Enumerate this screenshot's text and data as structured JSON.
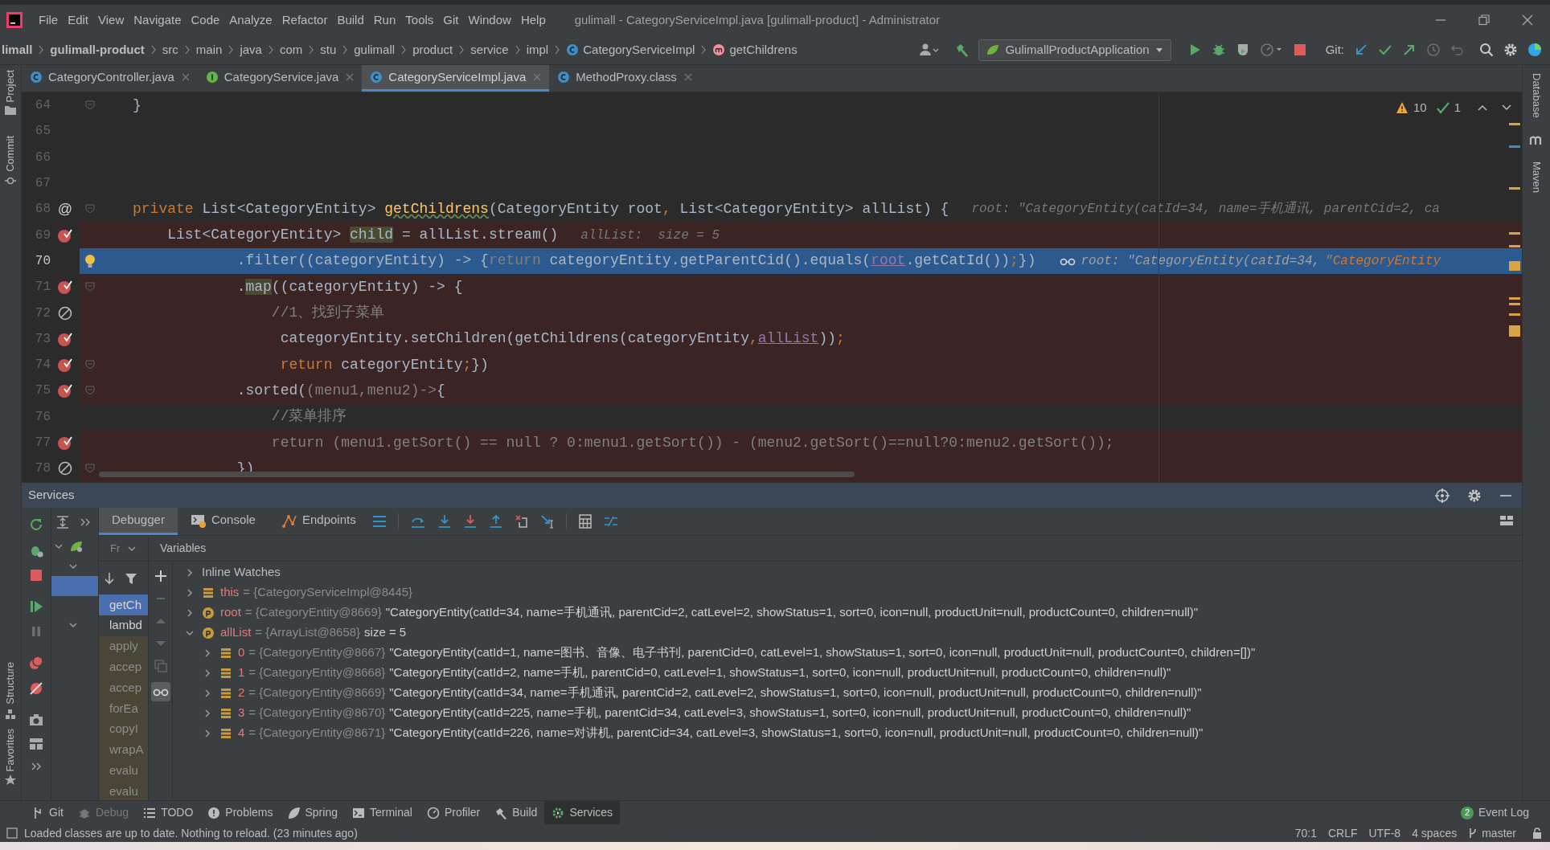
{
  "menu_bar": {
    "items": [
      "File",
      "Edit",
      "View",
      "Navigate",
      "Code",
      "Analyze",
      "Refactor",
      "Build",
      "Run",
      "Tools",
      "Git",
      "Window",
      "Help"
    ],
    "title": "gulimall - CategoryServiceImpl.java [gulimall-product] - Administrator"
  },
  "breadcrumbs": [
    {
      "label": "limall",
      "kind": "module"
    },
    {
      "label": "gulimall-product",
      "kind": "module"
    },
    {
      "label": "src",
      "kind": "folder"
    },
    {
      "label": "main",
      "kind": "folder"
    },
    {
      "label": "java",
      "kind": "folder"
    },
    {
      "label": "com",
      "kind": "folder"
    },
    {
      "label": "stu",
      "kind": "folder"
    },
    {
      "label": "gulimall",
      "kind": "folder"
    },
    {
      "label": "product",
      "kind": "folder"
    },
    {
      "label": "service",
      "kind": "folder"
    },
    {
      "label": "impl",
      "kind": "folder"
    },
    {
      "label": "CategoryServiceImpl",
      "kind": "class"
    },
    {
      "label": "getChildrens",
      "kind": "method"
    }
  ],
  "run_configuration": "GulimallProductApplication",
  "git_label": "Git:",
  "editor_tabs": [
    {
      "label": "CategoryController.java",
      "kind": "class",
      "selected": false
    },
    {
      "label": "CategoryService.java",
      "kind": "interface",
      "selected": false
    },
    {
      "label": "CategoryServiceImpl.java",
      "kind": "class",
      "selected": true
    },
    {
      "label": "MethodProxy.class",
      "kind": "class",
      "selected": false
    }
  ],
  "inspections": {
    "warnings": "10",
    "passed": "1"
  },
  "code_lines": [
    {
      "number": "64",
      "breakpoint": false,
      "fold": true,
      "highlighted": false,
      "current": false,
      "tokens": [
        {
          "kind": "plain",
          "text": "}"
        }
      ]
    },
    {
      "number": "65",
      "breakpoint": false,
      "fold": false,
      "highlighted": false,
      "current": false
    },
    {
      "number": "66",
      "breakpoint": false,
      "fold": false,
      "highlighted": false,
      "current": false
    },
    {
      "number": "67",
      "breakpoint": false,
      "fold": false,
      "highlighted": false,
      "current": false
    },
    {
      "number": "68",
      "breakpoint": false,
      "gutter_text": "@",
      "fold": true,
      "highlighted": false,
      "current": false,
      "tokens": [
        {
          "kind": "keyword",
          "text": "private"
        },
        {
          "kind": "plain",
          "text": " List<CategoryEntity> "
        },
        {
          "kind": "declaration-typo",
          "text": "getChildrens"
        },
        {
          "kind": "plain",
          "text": "(CategoryEntity root"
        },
        {
          "kind": "keyword",
          "text": ", "
        },
        {
          "kind": "plain",
          "text": "List<CategoryEntity> allList) {"
        },
        {
          "kind": "hint",
          "text": "root: \"CategoryEntity(catId=34, name=手机通讯, parentCid=2, ca"
        }
      ]
    },
    {
      "number": "69",
      "breakpoint": true,
      "muted": false,
      "fold": false,
      "highlighted": true,
      "current": false,
      "tokens": [
        {
          "kind": "plain",
          "text": "    List<CategoryEntity> "
        },
        {
          "kind": "usage",
          "text": "child"
        },
        {
          "kind": "plain",
          "text": " = allList.stream()"
        },
        {
          "kind": "hint",
          "text": "allList:  size = 5"
        }
      ]
    },
    {
      "number": "70",
      "breakpoint": false,
      "bulb": true,
      "fold": false,
      "highlighted": false,
      "current": true,
      "tokens": [
        {
          "kind": "plain",
          "text": "            .filter((categoryEntity) -> {"
        },
        {
          "kind": "muted",
          "text": "return"
        },
        {
          "kind": "plain",
          "text": " categoryEntity.getParentCid().equals("
        },
        {
          "kind": "field",
          "text": "root"
        },
        {
          "kind": "plain",
          "text": ".getCatId())"
        },
        {
          "kind": "keyword",
          "text": ";"
        },
        {
          "kind": "plain",
          "text": "})"
        },
        {
          "kind": "watch",
          "text": "root: \"CategoryEntity(catId=34,"
        },
        {
          "kind": "overlap",
          "text": "\"CategoryEntity"
        }
      ]
    },
    {
      "number": "71",
      "breakpoint": true,
      "muted": false,
      "fold": true,
      "highlighted": true,
      "current": false,
      "tokens": [
        {
          "kind": "plain",
          "text": "            ."
        },
        {
          "kind": "usage",
          "text": "map"
        },
        {
          "kind": "plain",
          "text": "((categoryEntity) -> {"
        }
      ]
    },
    {
      "number": "72",
      "breakpoint": true,
      "muted": true,
      "fold": false,
      "highlighted": true,
      "current": false,
      "tokens": [
        {
          "kind": "comment",
          "text": "                //1、找到子菜单"
        }
      ]
    },
    {
      "number": "73",
      "breakpoint": true,
      "muted": false,
      "fold": false,
      "highlighted": true,
      "current": false,
      "tokens": [
        {
          "kind": "plain",
          "text": "                 categoryEntity.setChildren(getChildrens(categoryEntity"
        },
        {
          "kind": "keyword",
          "text": ","
        },
        {
          "kind": "field",
          "text": "allList"
        },
        {
          "kind": "plain",
          "text": "))"
        },
        {
          "kind": "keyword",
          "text": ";"
        }
      ]
    },
    {
      "number": "74",
      "breakpoint": true,
      "muted": false,
      "fold": true,
      "highlighted": true,
      "current": false,
      "tokens": [
        {
          "kind": "keyword",
          "text": "                 return"
        },
        {
          "kind": "plain",
          "text": " categoryEntity"
        },
        {
          "kind": "keyword",
          "text": ";"
        },
        {
          "kind": "plain",
          "text": "})"
        }
      ]
    },
    {
      "number": "75",
      "breakpoint": true,
      "muted": false,
      "fold": true,
      "highlighted": true,
      "current": false,
      "tokens": [
        {
          "kind": "plain",
          "text": "            .sorted("
        },
        {
          "kind": "muted",
          "text": "(menu1,menu2)->"
        },
        {
          "kind": "plain",
          "text": "{"
        }
      ]
    },
    {
      "number": "76",
      "breakpoint": false,
      "fold": false,
      "highlighted": false,
      "current": false,
      "tokens": [
        {
          "kind": "comment",
          "text": "                //菜单排序"
        }
      ]
    },
    {
      "number": "77",
      "breakpoint": true,
      "muted": false,
      "fold": false,
      "highlighted": true,
      "current": false,
      "tokens": [
        {
          "kind": "muted",
          "text": "                return (menu1.getSort() == null ? 0:menu1.getSort()) - (menu2.getSort()==null?0:menu2.getSort());"
        }
      ]
    },
    {
      "number": "78",
      "breakpoint": true,
      "muted": true,
      "fold": true,
      "highlighted": true,
      "current": false,
      "tokens": [
        {
          "kind": "plain",
          "text": "            })"
        }
      ]
    }
  ],
  "tool_window": {
    "title": "Services",
    "service_tree": [
      {
        "expanded": true,
        "selected": false,
        "children": [
          {
            "expanded": true,
            "selected": false,
            "children": [
              {
                "selected": true
              }
            ]
          },
          {
            "expanded": true,
            "selected": false
          }
        ]
      }
    ],
    "tabs": [
      {
        "label": "Debugger",
        "kind": "debugger",
        "selected": true
      },
      {
        "label": "Console",
        "kind": "console",
        "selected": false
      },
      {
        "label": "Endpoints",
        "kind": "endpoints",
        "selected": false
      }
    ],
    "frames_label": "Fr",
    "variables_label": "Variables",
    "frames": [
      {
        "label": "getCh",
        "selected": true,
        "library": false
      },
      {
        "label": "lambd",
        "selected": false,
        "library": false
      },
      {
        "label": "apply",
        "selected": false,
        "library": true
      },
      {
        "label": "accep",
        "selected": false,
        "library": true
      },
      {
        "label": "accep",
        "selected": false,
        "library": true
      },
      {
        "label": "forEa",
        "selected": false,
        "library": true
      },
      {
        "label": "copyI",
        "selected": false,
        "library": true
      },
      {
        "label": "wrapA",
        "selected": false,
        "library": true
      },
      {
        "label": "evalu",
        "selected": false,
        "library": true
      },
      {
        "label": "evalu",
        "selected": false,
        "library": true
      }
    ],
    "variables": [
      {
        "name": "Inline Watches",
        "kind": "group",
        "expanded": false
      },
      {
        "name": "this",
        "kind": "field",
        "ref": "= {CategoryServiceImpl@8445}",
        "expanded": false
      },
      {
        "name": "root",
        "kind": "param",
        "ref": "= {CategoryEntity@8669}",
        "value": "\"CategoryEntity(catId=34, name=手机通讯, parentCid=2, catLevel=2, showStatus=1, sort=0, icon=null, productUnit=null, productCount=0, children=null)\"",
        "expanded": false
      },
      {
        "name": "allList",
        "kind": "param",
        "ref": "= {ArrayList@8658}",
        "value": "size = 5",
        "expanded": true,
        "children": [
          {
            "name": "0",
            "kind": "field",
            "ref": "= {CategoryEntity@8667}",
            "value": "\"CategoryEntity(catId=1, name=图书、音像、电子书刊, parentCid=0, catLevel=1, showStatus=1, sort=0, icon=null, productUnit=null, productCount=0, children=[])\"",
            "expanded": false
          },
          {
            "name": "1",
            "kind": "field",
            "ref": "= {CategoryEntity@8668}",
            "value": "\"CategoryEntity(catId=2, name=手机, parentCid=0, catLevel=1, showStatus=1, sort=0, icon=null, productUnit=null, productCount=0, children=null)\"",
            "expanded": false
          },
          {
            "name": "2",
            "kind": "field",
            "ref": "= {CategoryEntity@8669}",
            "value": "\"CategoryEntity(catId=34, name=手机通讯, parentCid=2, catLevel=2, showStatus=1, sort=0, icon=null, productUnit=null, productCount=0, children=null)\"",
            "expanded": false
          },
          {
            "name": "3",
            "kind": "field",
            "ref": "= {CategoryEntity@8670}",
            "value": "\"CategoryEntity(catId=225, name=手机, parentCid=34, catLevel=3, showStatus=1, sort=0, icon=null, productUnit=null, productCount=0, children=null)\"",
            "expanded": false
          },
          {
            "name": "4",
            "kind": "field",
            "ref": "= {CategoryEntity@8671}",
            "value": "\"CategoryEntity(catId=226, name=对讲机, parentCid=34, catLevel=3, showStatus=1, sort=0, icon=null, productUnit=null, productCount=0, children=null)\"",
            "expanded": false
          }
        ]
      }
    ]
  },
  "side_panels": {
    "left_top": [
      "Project",
      "Commit"
    ],
    "left_bottom": [
      "Structure",
      "Favorites"
    ],
    "right": [
      "Database",
      "Maven"
    ]
  },
  "bottom_tools": [
    {
      "label": "Git",
      "kind": "git",
      "selected": false,
      "disabled": false
    },
    {
      "label": "Debug",
      "kind": "debug",
      "selected": false,
      "disabled": true
    },
    {
      "label": "TODO",
      "kind": "todo",
      "selected": false,
      "disabled": false
    },
    {
      "label": "Problems",
      "kind": "problems",
      "selected": false,
      "disabled": false
    },
    {
      "label": "Spring",
      "kind": "spring",
      "selected": false,
      "disabled": false
    },
    {
      "label": "Terminal",
      "kind": "terminal",
      "selected": false,
      "disabled": false
    },
    {
      "label": "Profiler",
      "kind": "profiler",
      "selected": false,
      "disabled": false
    },
    {
      "label": "Build",
      "kind": "build",
      "selected": false,
      "disabled": false
    },
    {
      "label": "Services",
      "kind": "services",
      "selected": true,
      "disabled": false
    }
  ],
  "event_log": {
    "count": "2",
    "label": "Event Log"
  },
  "status_bar": {
    "message": "Loaded classes are up to date. Nothing to reload. (23 minutes ago)",
    "position": "70:1",
    "line_separator": "CRLF",
    "encoding": "UTF-8",
    "indent": "4 spaces",
    "branch": "master"
  }
}
